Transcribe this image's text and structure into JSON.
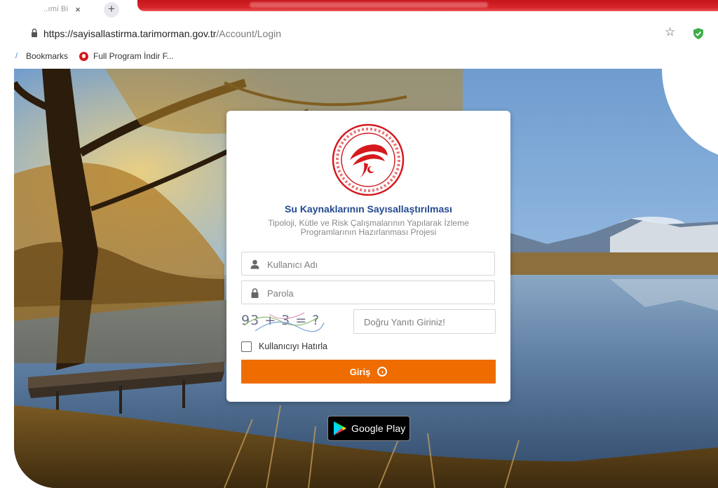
{
  "browser": {
    "tab_title": "..ımi Bi",
    "tab_close": "×",
    "new_tab": "+",
    "url_host": "https://sayisallastirma.tarimorman.gov.tr",
    "url_path": "/Account/Login",
    "bookmarks_label": "Bookmarks",
    "bookmark_item": "Full Program İndir F..."
  },
  "login": {
    "title": "Su Kaynaklarının Sayısallaştırılması",
    "subtitle": "Tipoloji, Kütle ve Risk Çalışmalarının Yapılarak İzleme Programlarının Hazırlanması Projesi",
    "username_placeholder": "Kullanıcı Adı",
    "password_placeholder": "Parola",
    "captcha_text": "93 + 3 = ?",
    "answer_placeholder": "Doğru Yanıtı Giriniz!",
    "remember_label": "Kullanıcıyı Hatırla",
    "login_button": "Giriş"
  },
  "store": {
    "label": "Google Play"
  },
  "colors": {
    "accent_orange": "#ef6c00",
    "title_blue": "#244a8f",
    "seal_red": "#d5191e",
    "tab_red": "#c4161c"
  }
}
